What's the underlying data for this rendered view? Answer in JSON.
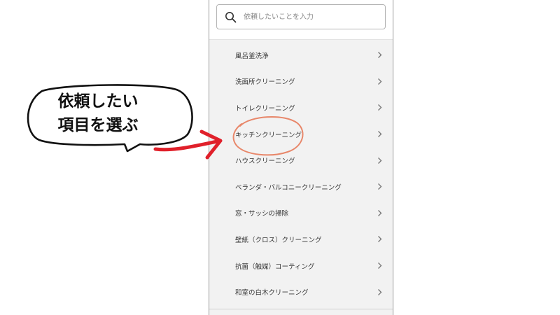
{
  "search": {
    "placeholder": "依頼したいことを入力"
  },
  "services": [
    {
      "label": "風呂釜洗浄"
    },
    {
      "label": "洗面所クリーニング"
    },
    {
      "label": "トイレクリーニング"
    },
    {
      "label": "キッチンクリーニング"
    },
    {
      "label": "ハウスクリーニング"
    },
    {
      "label": "ベランダ・バルコニークリーニング"
    },
    {
      "label": "窓・サッシの掃除"
    },
    {
      "label": "壁紙（クロス）クリーニング"
    },
    {
      "label": "抗菌（触媒）コーティング"
    },
    {
      "label": "和室の白木クリーニング"
    }
  ],
  "annotation": {
    "line1": "依頼したい",
    "line2": "項目を選ぶ",
    "highlighted_item": "キッチンクリーニング",
    "highlight_color": "#e8876a",
    "arrow_color": "#e0202a"
  },
  "icons": {
    "search": "search-icon",
    "chevron": "chevron-right-icon"
  }
}
